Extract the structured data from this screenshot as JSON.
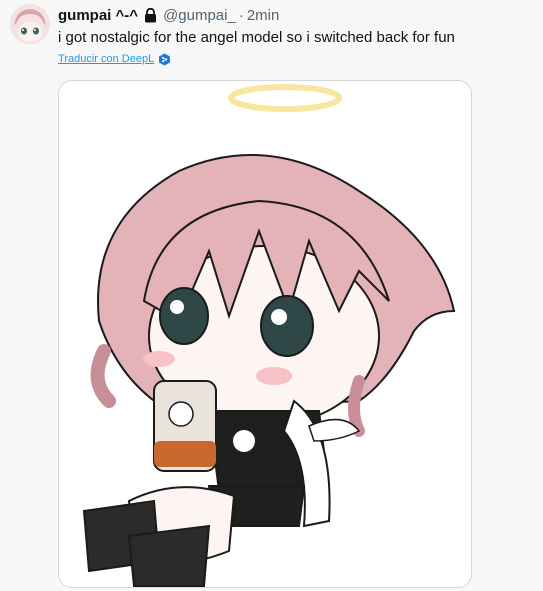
{
  "tweet": {
    "display_name": "gumpai ^-^",
    "handle": "@gumpai_",
    "separator": "·",
    "time": "2min",
    "text": "i got nostalgic for the angel model so i switched back for fun",
    "translate_label": "Traducir con DeepL"
  },
  "icons": {
    "lock": "lock-icon",
    "deepl": "deepl-icon"
  },
  "colors": {
    "link": "#1d9bf0",
    "secondary_text": "#536471",
    "border": "#d3d7db"
  }
}
